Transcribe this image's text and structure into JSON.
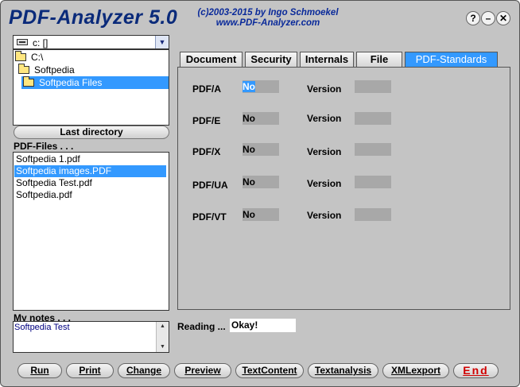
{
  "app": {
    "title": "PDF-Analyzer 5.0",
    "copyright_line1": "(c)2003-2015 by Ingo Schmoekel",
    "copyright_line2": "www.PDF-Analyzer.com"
  },
  "window_buttons": {
    "help": "?",
    "minimize": "–",
    "close": "✕"
  },
  "drive": {
    "value": "c: []",
    "dropdown_icon": "▼"
  },
  "directories": [
    {
      "label": "C:\\",
      "selected": false
    },
    {
      "label": "Softpedia",
      "selected": false
    },
    {
      "label": "Softpedia Files",
      "selected": true
    }
  ],
  "last_directory_label": "Last directory",
  "pdf_files_label": "PDF-Files . . .",
  "files": [
    {
      "name": "Softpedia 1.pdf",
      "selected": false
    },
    {
      "name": "Softpedia images.PDF",
      "selected": true
    },
    {
      "name": "Softpedia Test.pdf",
      "selected": false
    },
    {
      "name": "Softpedia.pdf",
      "selected": false
    }
  ],
  "notes": {
    "label": "My notes . . .",
    "text": "Softpedia Test"
  },
  "tabs": [
    {
      "label": "Document",
      "active": false
    },
    {
      "label": "Security",
      "active": false
    },
    {
      "label": "Internals",
      "active": false
    },
    {
      "label": "File",
      "active": false
    },
    {
      "label": "PDF-Standards",
      "active": true
    }
  ],
  "standards": [
    {
      "name": "PDF/A",
      "value": "No",
      "version_label": "Version",
      "version": ""
    },
    {
      "name": "PDF/E",
      "value": "No",
      "version_label": "Version",
      "version": ""
    },
    {
      "name": "PDF/X",
      "value": "No",
      "version_label": "Version",
      "version": ""
    },
    {
      "name": "PDF/UA",
      "value": "No",
      "version_label": "Version",
      "version": ""
    },
    {
      "name": "PDF/VT",
      "value": "No",
      "version_label": "Version",
      "version": ""
    }
  ],
  "status": {
    "label": "Reading ...",
    "value": "Okay!"
  },
  "buttons": {
    "run": "Run",
    "print": "Print",
    "change": "Change",
    "preview": "Preview",
    "textcontent": "TextContent",
    "textanalysis": "Textanalysis",
    "xmlexport": "XMLexport",
    "end": "End"
  },
  "colors": {
    "selection": "#3399ff",
    "title": "#0a2a7a",
    "end_button": "#d00000"
  }
}
